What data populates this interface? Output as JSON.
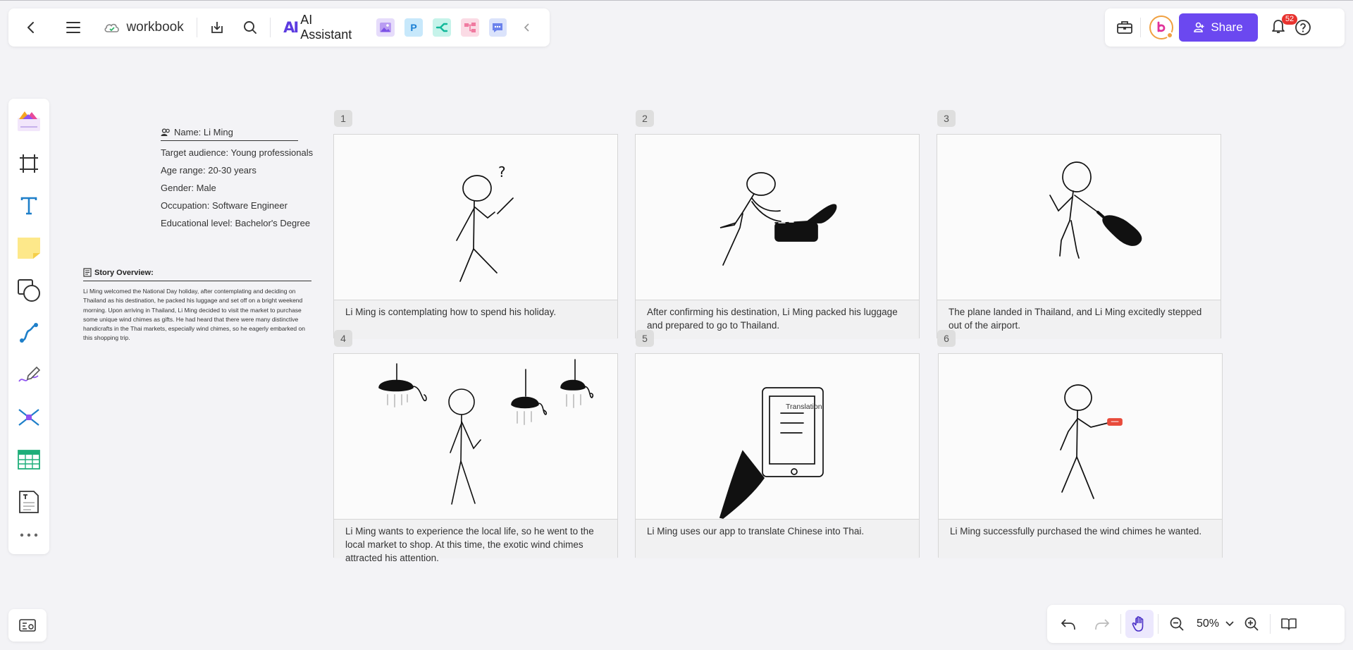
{
  "header": {
    "doc_name": "workbook",
    "ai_assistant_label": "AI Assistant",
    "ai_mark": "AI",
    "app_icon_p": "P"
  },
  "header_right": {
    "share_label": "Share",
    "notification_count": "52"
  },
  "persona": {
    "name": "Name: Li Ming",
    "attributes": [
      "Target audience: Young professionals",
      "Age range: 20-30 years",
      "Gender: Male",
      "Occupation: Software Engineer",
      "Educational level: Bachelor's Degree"
    ]
  },
  "overview": {
    "title": "Story Overview:",
    "text": "Li Ming welcomed the National Day holiday, after contemplating and deciding on Thailand as his destination, he packed his luggage and set off on a bright weekend morning. Upon arriving in Thailand, Li Ming decided to visit the market to purchase some unique wind chimes as gifts. He had heard that there were many distinctive handicrafts in the Thai markets, especially wind chimes, so he eagerly embarked on this shopping trip."
  },
  "frames": [
    {
      "number": "1",
      "caption": "Li Ming is contemplating how to spend his holiday.",
      "sketch_text": "?"
    },
    {
      "number": "2",
      "caption": "After confirming his destination, Li Ming packed his luggage and prepared to go to Thailand."
    },
    {
      "number": "3",
      "caption": "The plane landed in Thailand, and Li Ming excitedly stepped out of the airport."
    },
    {
      "number": "4",
      "caption": "Li Ming wants to experience the local life, so he went to the local market to shop. At this time, the exotic wind chimes attracted his attention."
    },
    {
      "number": "5",
      "caption": "Li Ming uses our app to translate Chinese into Thai.",
      "sketch_text": "Translation"
    },
    {
      "number": "6",
      "caption": "Li Ming successfully purchased the wind chimes he wanted."
    }
  ],
  "zoom": {
    "value": "50%"
  },
  "colors": {
    "accent": "#6b48f0",
    "badge": "#e8332f",
    "background": "#f3f3f6"
  },
  "icons": [
    "back-icon",
    "menu-icon",
    "cloud-sync-icon",
    "download-icon",
    "search-icon",
    "image-app-icon",
    "p-app-icon",
    "flow-app-icon",
    "mindmap-app-icon",
    "chat-app-icon",
    "collapse-icon",
    "briefcase-icon",
    "share-user-icon",
    "bell-icon",
    "help-icon",
    "template-icon",
    "frame-icon",
    "text-icon",
    "sticky-note-icon",
    "shape-icon",
    "connector-icon",
    "pen-icon",
    "mindmap-icon",
    "table-icon",
    "document-icon",
    "more-icon",
    "legend-icon",
    "undo-icon",
    "redo-icon",
    "hand-icon",
    "zoom-out-icon",
    "zoom-in-icon",
    "book-icon"
  ]
}
